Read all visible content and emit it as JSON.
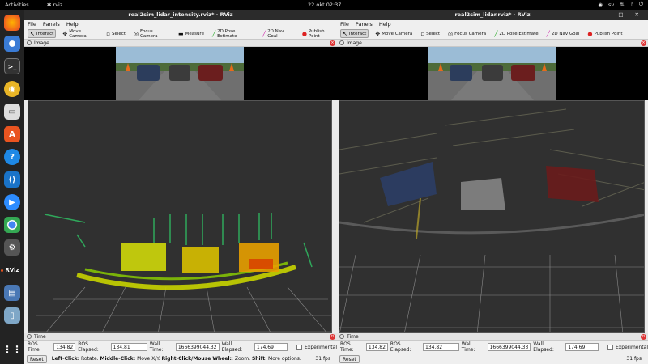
{
  "topbar": {
    "activities": "Activities",
    "app": "rviz",
    "clock": "22 okt  02:37",
    "lang": "sv"
  },
  "left_window": {
    "title": "real2sim_lidar_intensity.rviz* - RViz",
    "menus": [
      "File",
      "Panels",
      "Help"
    ],
    "tools": [
      {
        "label": "Interact",
        "icon": "interact-icon"
      },
      {
        "label": "Move Camera",
        "icon": "move-camera-icon"
      },
      {
        "label": "Select",
        "icon": "select-icon"
      },
      {
        "label": "Focus Camera",
        "icon": "focus-camera-icon"
      },
      {
        "label": "Measure",
        "icon": "measure-icon"
      },
      {
        "label": "2D Pose Estimate",
        "icon": "pose-estimate-icon"
      },
      {
        "label": "2D Nav Goal",
        "icon": "nav-goal-icon"
      },
      {
        "label": "Publish Point",
        "icon": "publish-point-icon"
      }
    ],
    "image_panel": "Image",
    "time_panel": "Time",
    "ros_time_label": "ROS Time:",
    "ros_time": "134.82",
    "ros_elapsed_label": "ROS Elapsed:",
    "ros_elapsed": "134.81",
    "wall_time_label": "Wall Time:",
    "wall_time": "1666399044.32",
    "wall_elapsed_label": "Wall Elapsed:",
    "wall_elapsed": "174.69",
    "experimental": "Experimental",
    "reset": "Reset",
    "hint_b1": "Left-Click:",
    "hint_t1": " Rotate. ",
    "hint_b2": "Middle-Click:",
    "hint_t2": " Move X/Y. ",
    "hint_b3": "Right-Click/Mouse Wheel:",
    "hint_t3": ": Zoom. ",
    "hint_b4": "Shift",
    "hint_t4": ": More options.",
    "fps": "31 fps"
  },
  "right_window": {
    "title": "real2sim_lidar.rviz* - RViz",
    "menus": [
      "File",
      "Panels",
      "Help"
    ],
    "tools": [
      {
        "label": "Interact",
        "icon": "interact-icon"
      },
      {
        "label": "Move Camera",
        "icon": "move-camera-icon"
      },
      {
        "label": "Select",
        "icon": "select-icon"
      },
      {
        "label": "Focus Camera",
        "icon": "focus-camera-icon"
      },
      {
        "label": "2D Pose Estimate",
        "icon": "pose-estimate-icon"
      },
      {
        "label": "2D Nav Goal",
        "icon": "nav-goal-icon"
      },
      {
        "label": "Publish Point",
        "icon": "publish-point-icon"
      }
    ],
    "image_panel": "Image",
    "time_panel": "Time",
    "ros_time_label": "ROS Time:",
    "ros_time": "134.82",
    "ros_elapsed_label": "ROS Elapsed:",
    "ros_elapsed": "134.82",
    "wall_time_label": "Wall Time:",
    "wall_time": "1666399044.33",
    "wall_elapsed_label": "Wall Elapsed:",
    "wall_elapsed": "174.69",
    "experimental": "Experimental",
    "reset": "Reset",
    "fps": "31 fps"
  },
  "dock": [
    "firefox-icon",
    "chromium-icon",
    "terminal-icon",
    "rhythmbox-icon",
    "files-icon",
    "software-icon",
    "help-icon",
    "vscode-icon",
    "zoom-icon",
    "chrome-icon",
    "settings-icon",
    "rviz-icon",
    "storage-icon",
    "trash-icon",
    "apps-grid-icon"
  ],
  "dock_rviz_label": "RViz",
  "colors": {
    "titlebar": "#2b2b2b",
    "accent": "#e95420",
    "viewport": "#303030"
  }
}
